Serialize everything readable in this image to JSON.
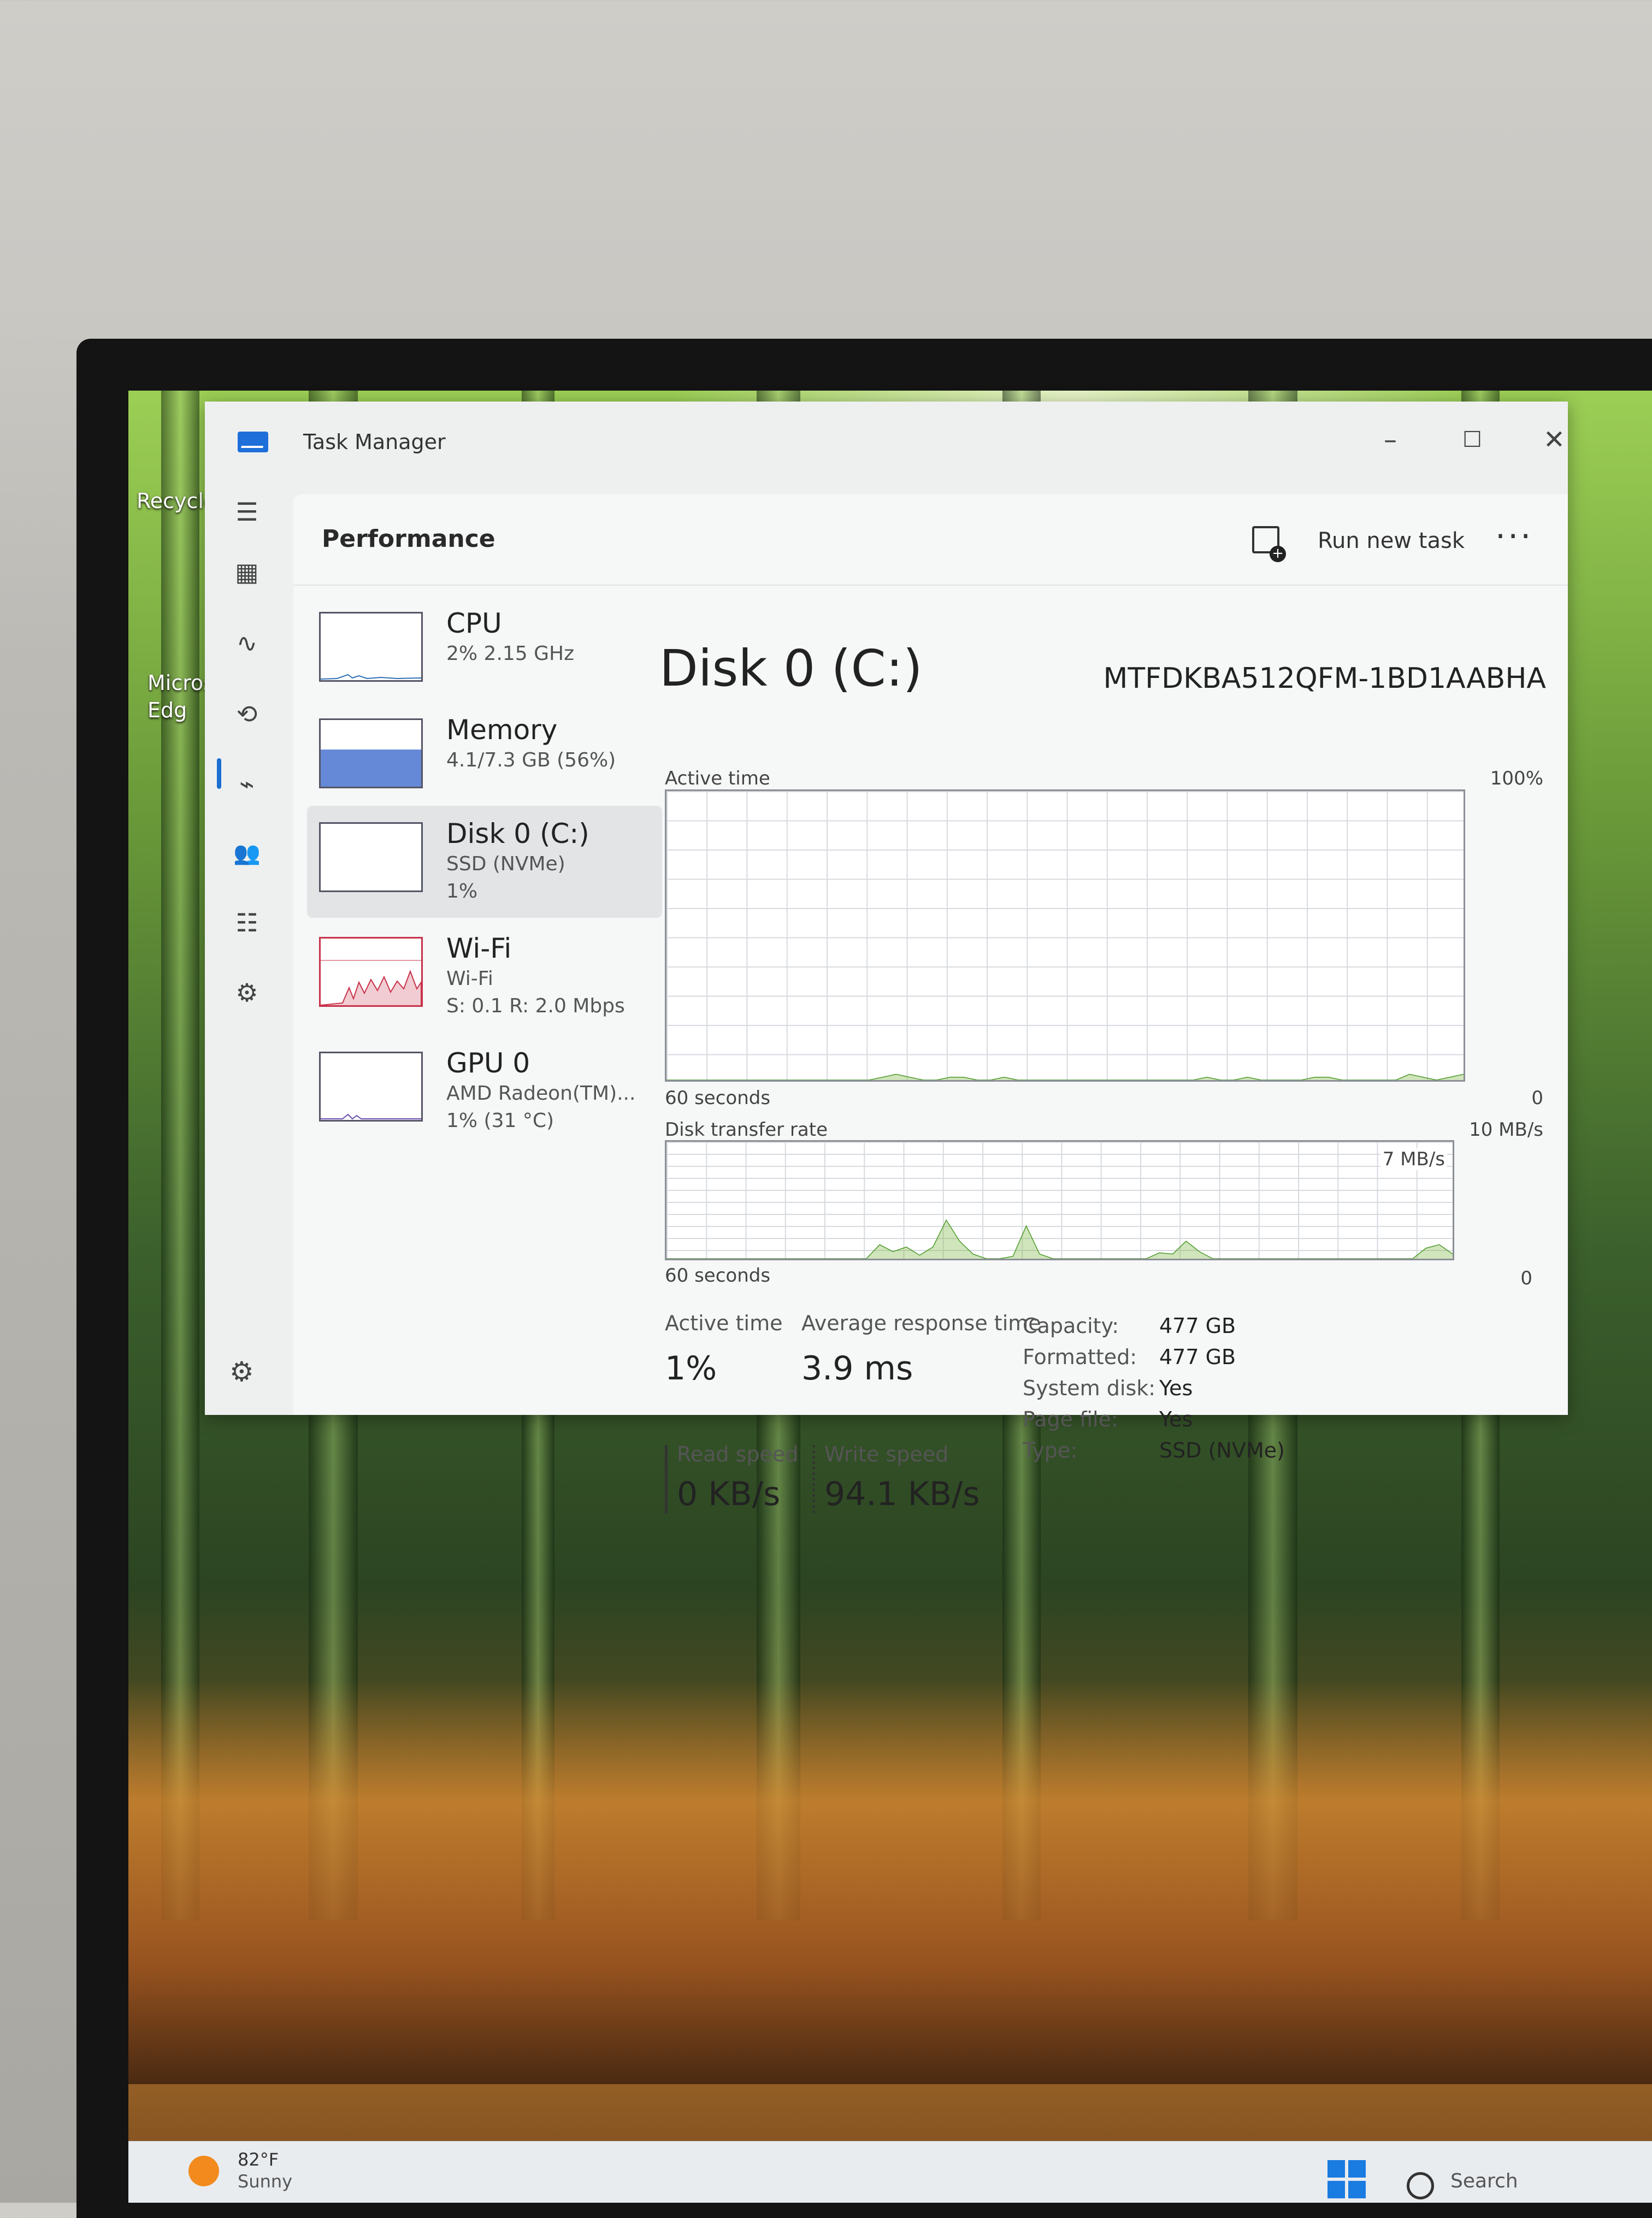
{
  "window": {
    "title": "Task Manager",
    "minimize": "–",
    "maximize": "☐",
    "close": "✕"
  },
  "header": {
    "page_title": "Performance",
    "run_new_task": "Run new task",
    "more": "···"
  },
  "nav": {
    "icons": [
      "hamburger-menu-icon",
      "processes-icon",
      "performance-icon",
      "app-history-icon",
      "startup-apps-icon",
      "users-icon",
      "details-icon",
      "services-icon",
      "settings-icon"
    ],
    "glyphs": [
      "☰",
      "▦",
      "∿",
      "⟲",
      "⌁",
      "👥",
      "☷",
      "⚙",
      "⚙"
    ]
  },
  "resources": [
    {
      "title": "CPU",
      "lines": [
        "2% 2.15 GHz"
      ],
      "color": "#2f6fb3",
      "usage": 2
    },
    {
      "title": "Memory",
      "lines": [
        "4.1/7.3 GB (56%)"
      ],
      "color": "#4a74d0",
      "usage": 56
    },
    {
      "title": "Disk 0 (C:)",
      "lines": [
        "SSD (NVMe)",
        "1%"
      ],
      "color": "#4c9a2a",
      "usage": 1
    },
    {
      "title": "Wi-Fi",
      "lines": [
        "Wi-Fi",
        "S: 0.1 R: 2.0 Mbps"
      ],
      "color": "#c8324a",
      "usage": 40
    },
    {
      "title": "GPU 0",
      "lines": [
        "AMD Radeon(TM)...",
        "1% (31 °C)"
      ],
      "color": "#6a4fb0",
      "usage": 1
    }
  ],
  "detail": {
    "title": "Disk 0 (C:)",
    "model": "MTFDKBA512QFM-1BD1AABHA",
    "chart1": {
      "label": "Active time",
      "max": "100%",
      "time": "60 seconds",
      "min": "0"
    },
    "chart2": {
      "label": "Disk transfer rate",
      "max": "10 MB/s",
      "mid": "7 MB/s",
      "time": "60 seconds",
      "min": "0"
    },
    "stats": {
      "active_time_label": "Active time",
      "active_time": "1%",
      "avg_resp_label": "Average response time",
      "avg_resp": "3.9 ms",
      "read_label": "Read speed",
      "read": "0 KB/s",
      "write_label": "Write speed",
      "write": "94.1 KB/s"
    },
    "props": [
      {
        "k": "Capacity:",
        "v": "477 GB"
      },
      {
        "k": "Formatted:",
        "v": "477 GB"
      },
      {
        "k": "System disk:",
        "v": "Yes"
      },
      {
        "k": "Page file:",
        "v": "Yes"
      },
      {
        "k": "Type:",
        "v": "SSD (NVMe)"
      }
    ]
  },
  "chart_data": [
    {
      "type": "area",
      "title": "Active time",
      "ylim": [
        0,
        100
      ],
      "x_range_seconds": 60,
      "values": [
        0,
        0,
        0,
        0,
        0,
        0,
        0,
        0,
        0,
        0,
        0,
        0,
        0,
        0,
        0,
        0,
        1,
        2,
        1,
        0,
        0,
        1,
        1,
        0,
        0,
        1,
        0,
        0,
        0,
        0,
        0,
        0,
        0,
        0,
        0,
        0,
        0,
        0,
        0,
        0,
        1,
        0,
        0,
        1,
        0,
        0,
        0,
        0,
        1,
        1,
        0,
        0,
        0,
        0,
        0,
        2,
        1,
        0,
        1,
        2
      ]
    },
    {
      "type": "area",
      "title": "Disk transfer rate",
      "ylim": [
        0,
        10
      ],
      "y_unit": "MB/s",
      "x_range_seconds": 60,
      "values": [
        0,
        0,
        0,
        0,
        0,
        0,
        0,
        0,
        0,
        0,
        0,
        0,
        0,
        0,
        0,
        0,
        1.2,
        0.6,
        1.0,
        0.3,
        1.0,
        3.3,
        1.5,
        0.4,
        0,
        0,
        0.2,
        2.8,
        0.4,
        0,
        0,
        0,
        0,
        0,
        0,
        0,
        0,
        0.5,
        0.4,
        1.5,
        0.6,
        0,
        0,
        0,
        0,
        0,
        0,
        0,
        0,
        0,
        0,
        0,
        0,
        0,
        0,
        0,
        0,
        0.9,
        1.2,
        0.4
      ]
    }
  ],
  "desktop": {
    "icons": [
      "Recycle",
      "Micros\nEdg"
    ],
    "weather": {
      "temp": "82°F",
      "condition": "Sunny"
    },
    "search": "Search"
  }
}
